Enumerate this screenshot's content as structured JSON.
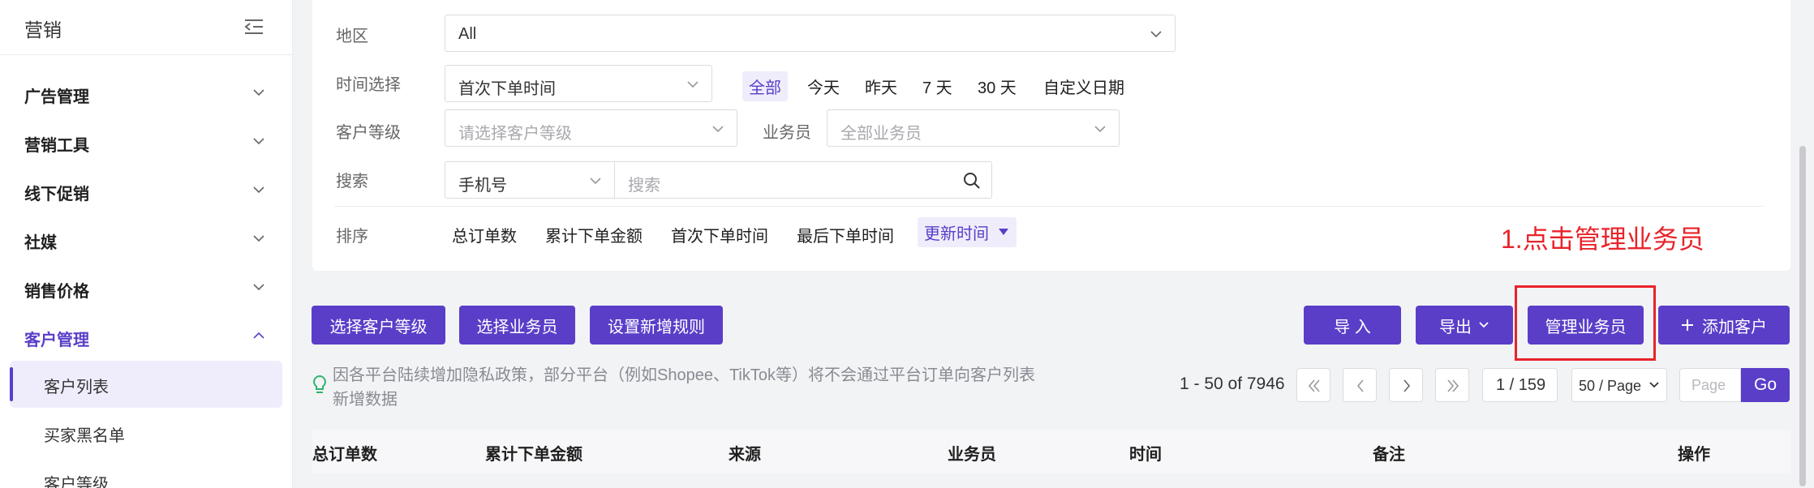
{
  "sidebar": {
    "title": "营销",
    "items": [
      {
        "label": "广告管理"
      },
      {
        "label": "营销工具"
      },
      {
        "label": "线下促销"
      },
      {
        "label": "社媒"
      },
      {
        "label": "销售价格"
      },
      {
        "label": "客户管理"
      }
    ],
    "sub_items": [
      {
        "label": "客户列表"
      },
      {
        "label": "买家黑名单"
      },
      {
        "label": "客户等级"
      }
    ]
  },
  "filters": {
    "region": {
      "label": "地区",
      "value": "All"
    },
    "time": {
      "label": "时间选择",
      "select_value": "首次下单时间",
      "options": [
        "全部",
        "今天",
        "昨天",
        "7 天",
        "30 天",
        "自定义日期"
      ],
      "selected": "全部"
    },
    "level": {
      "label": "客户等级",
      "placeholder": "请选择客户等级"
    },
    "salesman": {
      "label": "业务员",
      "placeholder": "全部业务员"
    },
    "search": {
      "label": "搜索",
      "field": "手机号",
      "placeholder": "搜索"
    },
    "sort": {
      "label": "排序",
      "options": [
        "总订单数",
        "累计下单金额",
        "首次下单时间",
        "最后下单时间",
        "更新时间"
      ],
      "selected": "更新时间"
    }
  },
  "annotation": "1.点击管理业务员",
  "toolbar": {
    "select_level": "选择客户等级",
    "select_salesman": "选择业务员",
    "set_rule": "设置新增规则",
    "import": "导 入",
    "export": "导出",
    "manage_salesman": "管理业务员",
    "add_customer": "添加客户"
  },
  "tip": "因各平台陆续增加隐私政策，部分平台（例如Shopee、TikTok等）将不会通过平台订单向客户列表新增数据",
  "pagination": {
    "range": "1 - 50 of 7946",
    "page": "1 / 159",
    "per_page": "50 / Page",
    "jump_placeholder": "Page",
    "go": "Go"
  },
  "table": {
    "columns": [
      "总订单数",
      "累计下单金额",
      "来源",
      "业务员",
      "时间",
      "备注",
      "操作"
    ]
  },
  "colors": {
    "accent": "#5a3ec8",
    "annotation": "#e8232a"
  }
}
